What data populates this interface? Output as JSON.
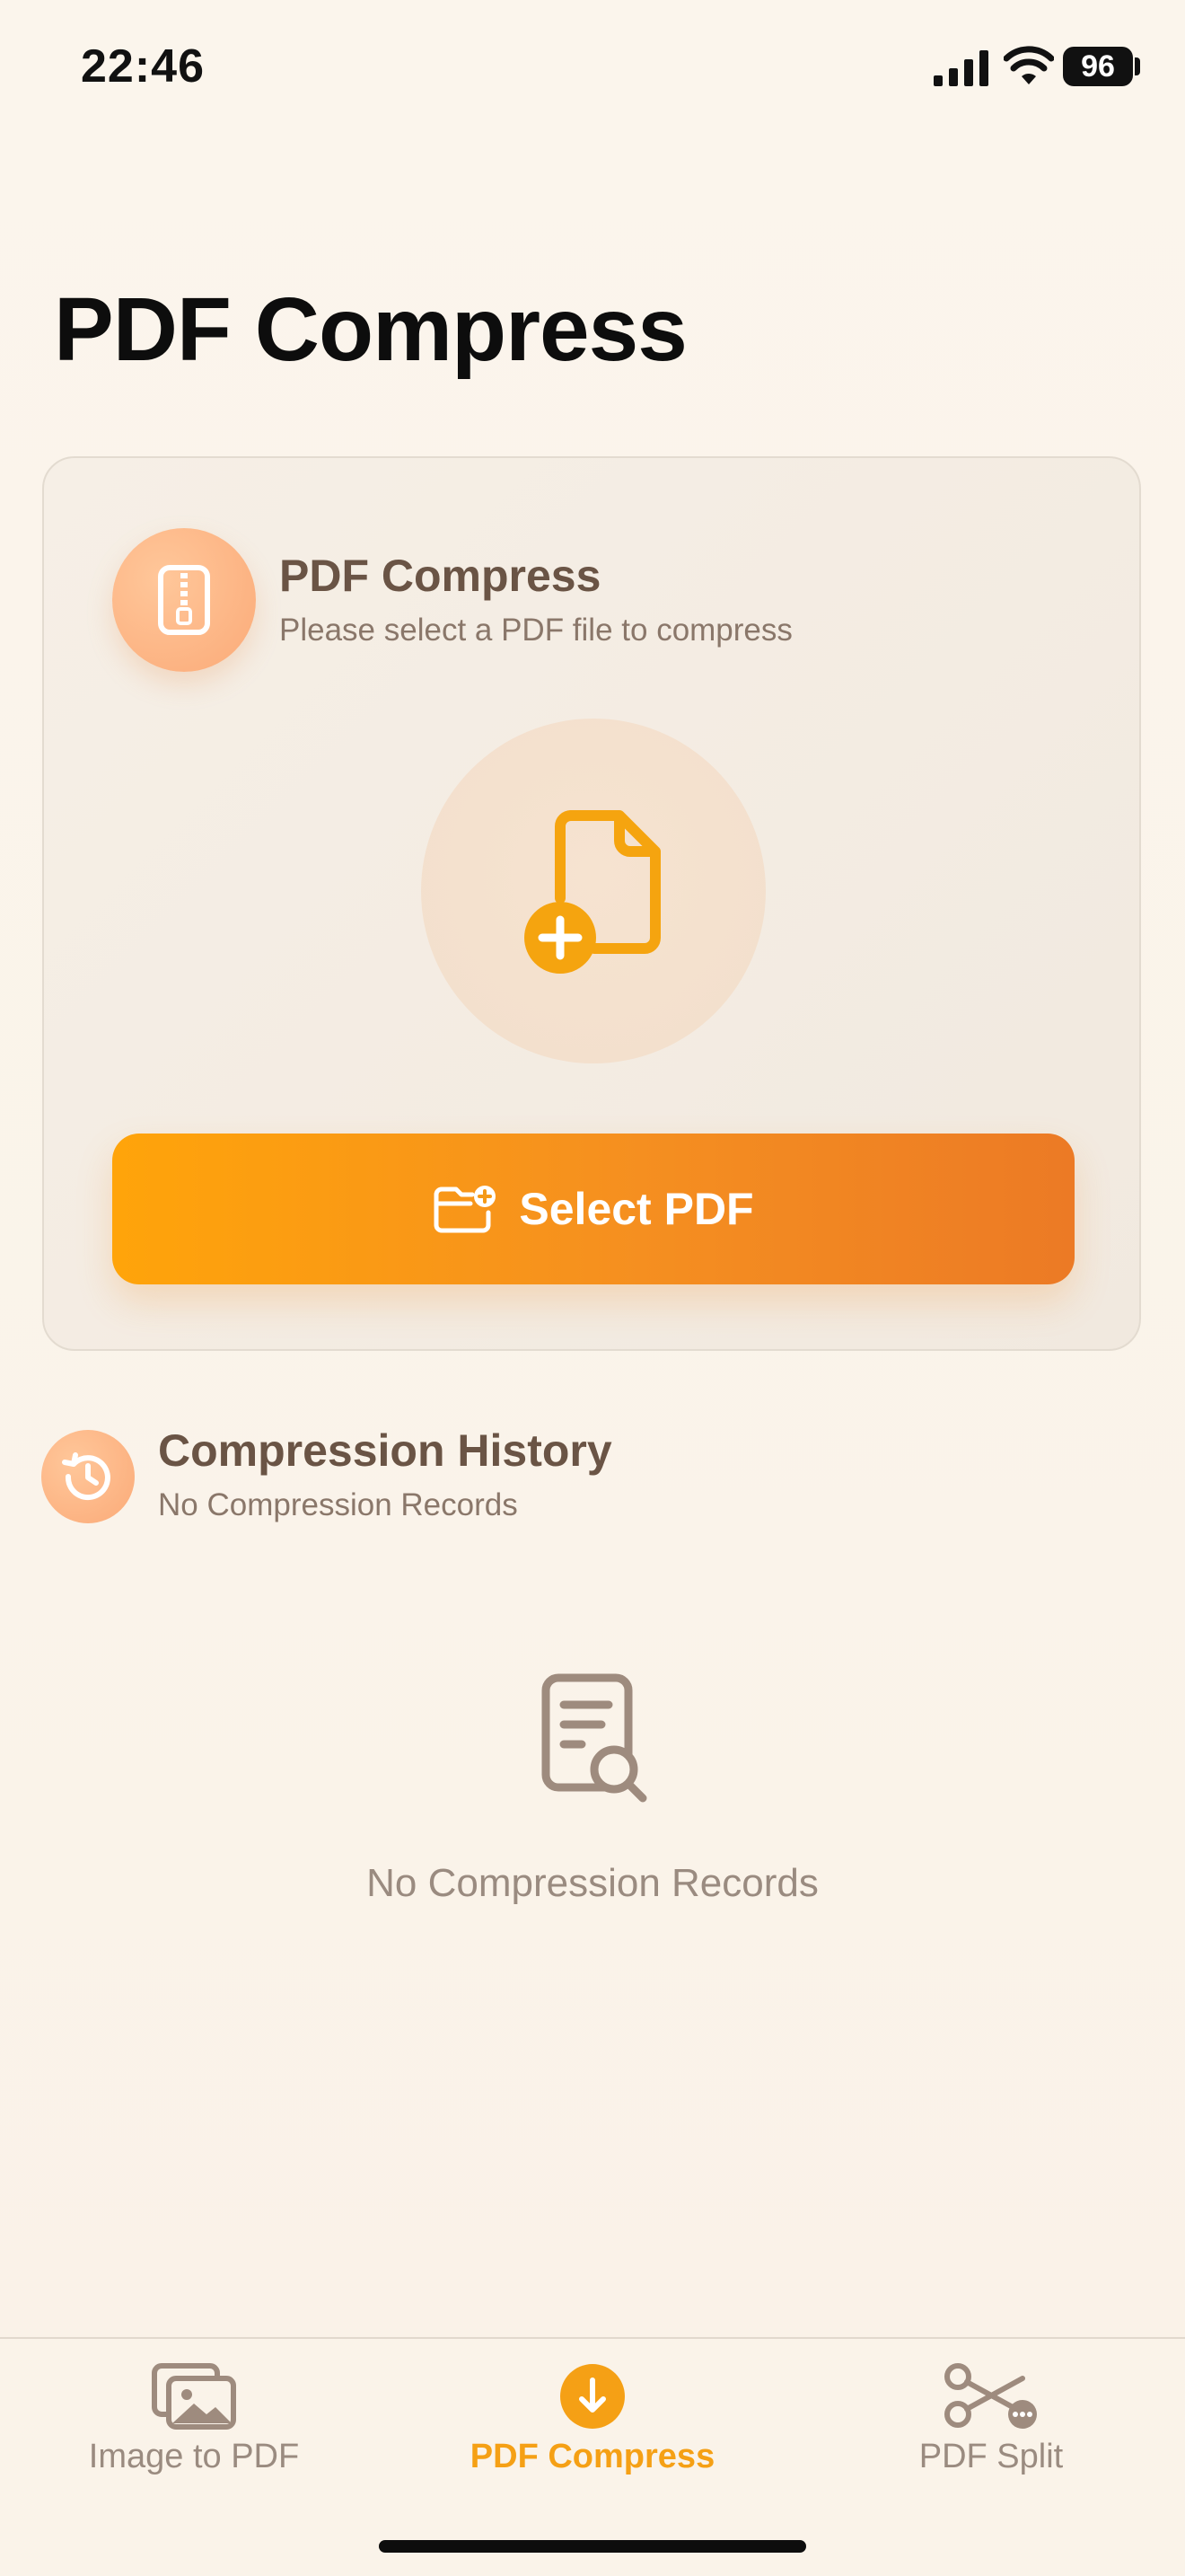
{
  "status_bar": {
    "time": "22:46",
    "battery": "96"
  },
  "page": {
    "title": "PDF Compress"
  },
  "compress_card": {
    "icon": "zipper-file-icon",
    "title": "PDF Compress",
    "subtitle": "Please select a PDF file to compress",
    "drop_icon": "file-add-icon",
    "button_icon": "folder-add-icon",
    "button_label": "Select PDF"
  },
  "history": {
    "icon": "history-icon",
    "title": "Compression History",
    "subtitle": "No Compression Records",
    "empty_icon": "document-search-icon",
    "empty_text": "No Compression Records"
  },
  "tab_bar": {
    "tabs": [
      {
        "label": "Image to PDF",
        "icon": "images-icon",
        "active": false
      },
      {
        "label": "PDF Compress",
        "icon": "arrow-down-circle-icon",
        "active": true
      },
      {
        "label": "PDF Split",
        "icon": "scissors-icon",
        "active": false
      }
    ]
  },
  "colors": {
    "accent": "#F5A015",
    "background": "#FAF3E9",
    "heading_text": "#6A5445",
    "muted_text": "#9A8B80"
  }
}
